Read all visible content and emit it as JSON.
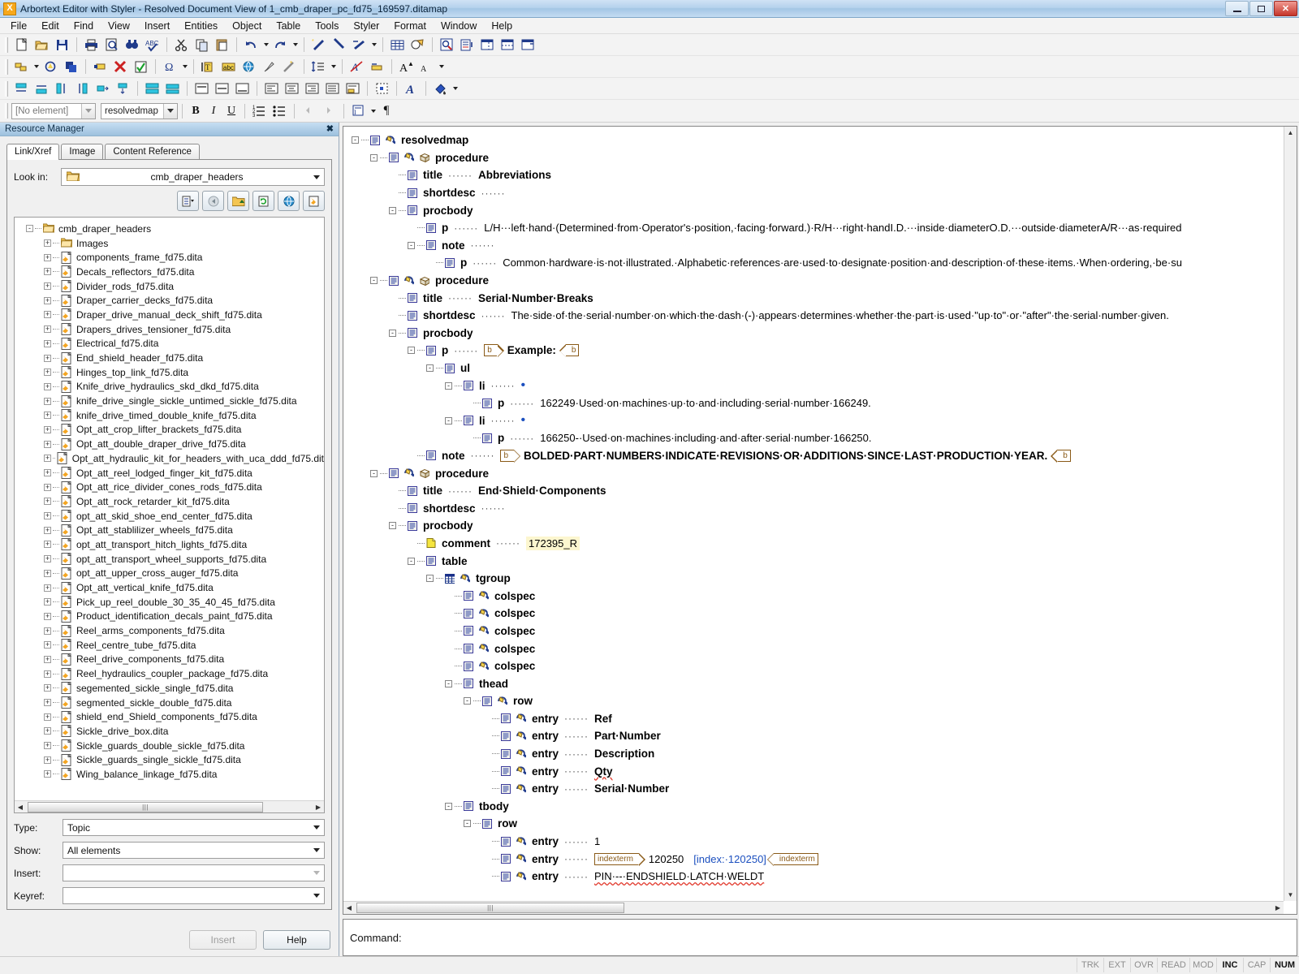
{
  "window": {
    "title": "Arbortext Editor with Styler - Resolved Document View of 1_cmb_draper_pc_fd75_169597.ditamap",
    "app_icon": "arbortext-icon",
    "minimize": "–",
    "restore": "❐",
    "close": "✕"
  },
  "menu": [
    {
      "label": "File"
    },
    {
      "label": "Edit"
    },
    {
      "label": "Find"
    },
    {
      "label": "View"
    },
    {
      "label": "Insert"
    },
    {
      "label": "Entities"
    },
    {
      "label": "Object"
    },
    {
      "label": "Table"
    },
    {
      "label": "Tools"
    },
    {
      "label": "Styler"
    },
    {
      "label": "Format"
    },
    {
      "label": "Window"
    },
    {
      "label": "Help"
    }
  ],
  "stylebar": {
    "element_combo_value": "[No element]",
    "context_combo_value": "resolvedmap",
    "bold": "B",
    "italic": "I",
    "underline": "U",
    "pilcrow": "¶"
  },
  "resource_manager": {
    "panel_title": "Resource Manager",
    "close_label": "✖",
    "tabs": [
      {
        "label": "Link/Xref",
        "active": true
      },
      {
        "label": "Image",
        "active": false
      },
      {
        "label": "Content Reference",
        "active": false
      }
    ],
    "look_in_label": "Look in:",
    "look_in_value": "cmb_draper_headers",
    "tree": [
      {
        "label": "cmb_draper_headers",
        "depth": 0,
        "type": "folder",
        "expander": "-"
      },
      {
        "label": "Images",
        "depth": 1,
        "type": "folder",
        "expander": "+"
      },
      {
        "label": "components_frame_fd75.dita",
        "depth": 1,
        "type": "file",
        "expander": "+"
      },
      {
        "label": "Decals_reflectors_fd75.dita",
        "depth": 1,
        "type": "file",
        "expander": "+"
      },
      {
        "label": "Divider_rods_fd75.dita",
        "depth": 1,
        "type": "file",
        "expander": "+"
      },
      {
        "label": "Draper_carrier_decks_fd75.dita",
        "depth": 1,
        "type": "file",
        "expander": "+"
      },
      {
        "label": "Draper_drive_manual_deck_shift_fd75.dita",
        "depth": 1,
        "type": "file",
        "expander": "+"
      },
      {
        "label": "Drapers_drives_tensioner_fd75.dita",
        "depth": 1,
        "type": "file",
        "expander": "+"
      },
      {
        "label": "Electrical_fd75.dita",
        "depth": 1,
        "type": "file",
        "expander": "+"
      },
      {
        "label": "End_shield_header_fd75.dita",
        "depth": 1,
        "type": "file",
        "expander": "+"
      },
      {
        "label": "Hinges_top_link_fd75.dita",
        "depth": 1,
        "type": "file",
        "expander": "+"
      },
      {
        "label": "Knife_drive_hydraulics_skd_dkd_fd75.dita",
        "depth": 1,
        "type": "file",
        "expander": "+"
      },
      {
        "label": "knife_drive_single_sickle_untimed_sickle_fd75.dita",
        "depth": 1,
        "type": "file",
        "expander": "+"
      },
      {
        "label": "knife_drive_timed_double_knife_fd75.dita",
        "depth": 1,
        "type": "file",
        "expander": "+"
      },
      {
        "label": "Opt_att_crop_lifter_brackets_fd75.dita",
        "depth": 1,
        "type": "file",
        "expander": "+"
      },
      {
        "label": "Opt_att_double_draper_drive_fd75.dita",
        "depth": 1,
        "type": "file",
        "expander": "+"
      },
      {
        "label": "Opt_att_hydraulic_kit_for_headers_with_uca_ddd_fd75.dit",
        "depth": 1,
        "type": "file",
        "expander": "+"
      },
      {
        "label": "Opt_att_reel_lodged_finger_kit_fd75.dita",
        "depth": 1,
        "type": "file",
        "expander": "+"
      },
      {
        "label": "Opt_att_rice_divider_cones_rods_fd75.dita",
        "depth": 1,
        "type": "file",
        "expander": "+"
      },
      {
        "label": "Opt_att_rock_retarder_kit_fd75.dita",
        "depth": 1,
        "type": "file",
        "expander": "+"
      },
      {
        "label": "opt_att_skid_shoe_end_center_fd75.dita",
        "depth": 1,
        "type": "file",
        "expander": "+"
      },
      {
        "label": "Opt_att_stablilizer_wheels_fd75.dita",
        "depth": 1,
        "type": "file",
        "expander": "+"
      },
      {
        "label": "opt_att_transport_hitch_lights_fd75.dita",
        "depth": 1,
        "type": "file",
        "expander": "+"
      },
      {
        "label": "opt_att_transport_wheel_supports_fd75.dita",
        "depth": 1,
        "type": "file",
        "expander": "+"
      },
      {
        "label": "opt_att_upper_cross_auger_fd75.dita",
        "depth": 1,
        "type": "file",
        "expander": "+"
      },
      {
        "label": "Opt_att_vertical_knife_fd75.dita",
        "depth": 1,
        "type": "file",
        "expander": "+"
      },
      {
        "label": "Pick_up_reel_double_30_35_40_45_fd75.dita",
        "depth": 1,
        "type": "file",
        "expander": "+"
      },
      {
        "label": "Product_identification_decals_paint_fd75.dita",
        "depth": 1,
        "type": "file",
        "expander": "+"
      },
      {
        "label": "Reel_arms_components_fd75.dita",
        "depth": 1,
        "type": "file",
        "expander": "+"
      },
      {
        "label": "Reel_centre_tube_fd75.dita",
        "depth": 1,
        "type": "file",
        "expander": "+"
      },
      {
        "label": "Reel_drive_components_fd75.dita",
        "depth": 1,
        "type": "file",
        "expander": "+"
      },
      {
        "label": "Reel_hydraulics_coupler_package_fd75.dita",
        "depth": 1,
        "type": "file",
        "expander": "+"
      },
      {
        "label": "segemented_sickle_single_fd75.dita",
        "depth": 1,
        "type": "file",
        "expander": "+"
      },
      {
        "label": "segmented_sickle_double_fd75.dita",
        "depth": 1,
        "type": "file",
        "expander": "+"
      },
      {
        "label": "shield_end_Shield_components_fd75.dita",
        "depth": 1,
        "type": "file",
        "expander": "+"
      },
      {
        "label": "Sickle_drive_box.dita",
        "depth": 1,
        "type": "file",
        "expander": "+"
      },
      {
        "label": "Sickle_guards_double_sickle_fd75.dita",
        "depth": 1,
        "type": "file",
        "expander": "+"
      },
      {
        "label": "Sickle_guards_single_sickle_fd75.dita",
        "depth": 1,
        "type": "file",
        "expander": "+"
      },
      {
        "label": "Wing_balance_linkage_fd75.dita",
        "depth": 1,
        "type": "file",
        "expander": "+"
      }
    ],
    "fields": [
      {
        "label": "Type:",
        "value": "Topic",
        "enabled": true
      },
      {
        "label": "Show:",
        "value": "All elements",
        "enabled": true
      },
      {
        "label": "Insert:",
        "value": "",
        "enabled": false
      },
      {
        "label": "Keyref:",
        "value": "",
        "enabled": true
      }
    ],
    "buttons": [
      {
        "label": "Insert",
        "enabled": false
      },
      {
        "label": "Help",
        "enabled": true
      }
    ]
  },
  "doctree": {
    "nodes": [
      {
        "depth": 0,
        "exp": "-",
        "tag": "resolvedmap",
        "icons": [
          "element",
          "attr"
        ],
        "leader": false,
        "text": ""
      },
      {
        "depth": 1,
        "exp": "-",
        "tag": "procedure",
        "icons": [
          "element",
          "attr",
          "cube"
        ],
        "leader": false,
        "text": ""
      },
      {
        "depth": 2,
        "exp": "",
        "tag": "title",
        "icons": [
          "element"
        ],
        "leader": true,
        "text": "Abbreviations",
        "bold": true
      },
      {
        "depth": 2,
        "exp": "",
        "tag": "shortdesc",
        "icons": [
          "element"
        ],
        "leader": true,
        "text": ""
      },
      {
        "depth": 2,
        "exp": "-",
        "tag": "procbody",
        "icons": [
          "element"
        ],
        "leader": false,
        "text": ""
      },
      {
        "depth": 3,
        "exp": "",
        "tag": "p",
        "icons": [
          "element"
        ],
        "leader": true,
        "text": "L/H···left·hand·(Determined·from·Operator's·position,·facing·forward.)·R/H···right·handI.D.···inside·diameterO.D.···outside·diameterA/R···as·required"
      },
      {
        "depth": 3,
        "exp": "-",
        "tag": "note",
        "icons": [
          "element"
        ],
        "leader": true,
        "text": ""
      },
      {
        "depth": 4,
        "exp": "",
        "tag": "p",
        "icons": [
          "element"
        ],
        "leader": true,
        "text": "Common·hardware·is·not·illustrated.·Alphabetic·references·are·used·to·designate·position·and·description·of·these·items.·When·ordering,·be·su"
      },
      {
        "depth": 1,
        "exp": "-",
        "tag": "procedure",
        "icons": [
          "element",
          "attr",
          "cube"
        ],
        "leader": false,
        "text": ""
      },
      {
        "depth": 2,
        "exp": "",
        "tag": "title",
        "icons": [
          "element"
        ],
        "leader": true,
        "text": "Serial·Number·Breaks",
        "bold": true
      },
      {
        "depth": 2,
        "exp": "",
        "tag": "shortdesc",
        "icons": [
          "element"
        ],
        "leader": true,
        "text": "The·side·of·the·serial·number·on·which·the·dash·(-)·appears·determines·whether·the·part·is·used·\"up·to\"·or·\"after\"·the·serial·number·given."
      },
      {
        "depth": 2,
        "exp": "-",
        "tag": "procbody",
        "icons": [
          "element"
        ],
        "leader": false,
        "text": ""
      },
      {
        "depth": 3,
        "exp": "-",
        "tag": "p",
        "icons": [
          "element"
        ],
        "leader": true,
        "marker_start": "b",
        "text": "Example:",
        "marker_end": "b",
        "bold": true
      },
      {
        "depth": 4,
        "exp": "-",
        "tag": "ul",
        "icons": [
          "element"
        ],
        "leader": false,
        "text": ""
      },
      {
        "depth": 5,
        "exp": "-",
        "tag": "li",
        "icons": [
          "element"
        ],
        "leader": true,
        "text": "•",
        "bullet": true
      },
      {
        "depth": 6,
        "exp": "",
        "tag": "p",
        "icons": [
          "element"
        ],
        "leader": true,
        "text": "162249·Used·on·machines·up·to·and·including·serial·number·166249."
      },
      {
        "depth": 5,
        "exp": "-",
        "tag": "li",
        "icons": [
          "element"
        ],
        "leader": true,
        "text": "•",
        "bullet": true
      },
      {
        "depth": 6,
        "exp": "",
        "tag": "p",
        "icons": [
          "element"
        ],
        "leader": true,
        "text": "166250-·Used·on·machines·including·and·after·serial·number·166250."
      },
      {
        "depth": 3,
        "exp": "",
        "tag": "note",
        "icons": [
          "element"
        ],
        "leader": true,
        "marker_start": "b",
        "text": "BOLDED·PART·NUMBERS·INDICATE·REVISIONS·OR·ADDITIONS·SINCE·LAST·PRODUCTION·YEAR.",
        "marker_end": "b",
        "bold": true
      },
      {
        "depth": 1,
        "exp": "-",
        "tag": "procedure",
        "icons": [
          "element",
          "attr",
          "cube"
        ],
        "leader": false,
        "text": ""
      },
      {
        "depth": 2,
        "exp": "",
        "tag": "title",
        "icons": [
          "element"
        ],
        "leader": true,
        "text": "End·Shield·Components",
        "bold": true
      },
      {
        "depth": 2,
        "exp": "",
        "tag": "shortdesc",
        "icons": [
          "element"
        ],
        "leader": true,
        "text": ""
      },
      {
        "depth": 2,
        "exp": "-",
        "tag": "procbody",
        "icons": [
          "element"
        ],
        "leader": false,
        "text": ""
      },
      {
        "depth": 3,
        "exp": "",
        "tag": "comment",
        "icons": [
          "comment"
        ],
        "leader": true,
        "text": "172395_R",
        "highlight": true
      },
      {
        "depth": 3,
        "exp": "-",
        "tag": "table",
        "icons": [
          "element"
        ],
        "leader": false,
        "text": ""
      },
      {
        "depth": 4,
        "exp": "-",
        "tag": "tgroup",
        "icons": [
          "table",
          "attr"
        ],
        "leader": false,
        "text": ""
      },
      {
        "depth": 5,
        "exp": "",
        "tag": "colspec",
        "icons": [
          "element",
          "attr"
        ],
        "leader": false,
        "text": ""
      },
      {
        "depth": 5,
        "exp": "",
        "tag": "colspec",
        "icons": [
          "element",
          "attr"
        ],
        "leader": false,
        "text": ""
      },
      {
        "depth": 5,
        "exp": "",
        "tag": "colspec",
        "icons": [
          "element",
          "attr"
        ],
        "leader": false,
        "text": ""
      },
      {
        "depth": 5,
        "exp": "",
        "tag": "colspec",
        "icons": [
          "element",
          "attr"
        ],
        "leader": false,
        "text": ""
      },
      {
        "depth": 5,
        "exp": "",
        "tag": "colspec",
        "icons": [
          "element",
          "attr"
        ],
        "leader": false,
        "text": ""
      },
      {
        "depth": 5,
        "exp": "-",
        "tag": "thead",
        "icons": [
          "element"
        ],
        "leader": false,
        "text": ""
      },
      {
        "depth": 6,
        "exp": "-",
        "tag": "row",
        "icons": [
          "element",
          "attr"
        ],
        "leader": false,
        "text": ""
      },
      {
        "depth": 7,
        "exp": "",
        "tag": "entry",
        "icons": [
          "element",
          "attr"
        ],
        "leader": true,
        "text": "Ref",
        "bold": true
      },
      {
        "depth": 7,
        "exp": "",
        "tag": "entry",
        "icons": [
          "element",
          "attr"
        ],
        "leader": true,
        "text": "Part·Number",
        "bold": true
      },
      {
        "depth": 7,
        "exp": "",
        "tag": "entry",
        "icons": [
          "element",
          "attr"
        ],
        "leader": true,
        "text": "Description",
        "bold": true
      },
      {
        "depth": 7,
        "exp": "",
        "tag": "entry",
        "icons": [
          "element",
          "attr"
        ],
        "leader": true,
        "text": "Qty",
        "bold": true,
        "spell": true
      },
      {
        "depth": 7,
        "exp": "",
        "tag": "entry",
        "icons": [
          "element",
          "attr"
        ],
        "leader": true,
        "text": "Serial·Number",
        "bold": true
      },
      {
        "depth": 5,
        "exp": "-",
        "tag": "tbody",
        "icons": [
          "element"
        ],
        "leader": false,
        "text": ""
      },
      {
        "depth": 6,
        "exp": "-",
        "tag": "row",
        "icons": [
          "element"
        ],
        "leader": false,
        "text": ""
      },
      {
        "depth": 7,
        "exp": "",
        "tag": "entry",
        "icons": [
          "element",
          "attr"
        ],
        "leader": true,
        "text": "1"
      },
      {
        "depth": 7,
        "exp": "",
        "tag": "entry",
        "icons": [
          "element",
          "attr"
        ],
        "leader": true,
        "text": "120250",
        "marker_start": "indexterm",
        "marker_mid": "[index:·120250]",
        "marker_end": "indexterm"
      },
      {
        "depth": 7,
        "exp": "",
        "tag": "entry",
        "icons": [
          "element",
          "attr"
        ],
        "leader": true,
        "text": "PIN·--·ENDSHIELD·LATCH·WELDT",
        "spell": true
      }
    ]
  },
  "command_bar": {
    "label": "Command:",
    "value": ""
  },
  "statusbar": {
    "cells": [
      {
        "label": "TRK",
        "on": false
      },
      {
        "label": "EXT",
        "on": false
      },
      {
        "label": "OVR",
        "on": false
      },
      {
        "label": "READ",
        "on": false
      },
      {
        "label": "MOD",
        "on": false
      },
      {
        "label": "INC",
        "on": true
      },
      {
        "label": "CAP",
        "on": false
      },
      {
        "label": "NUM",
        "on": true
      }
    ]
  },
  "colors": {
    "title_blue": "#a3c6e5",
    "tag_black": "#000000",
    "marker_brown": "#8a5a17",
    "index_blue": "#1b4fbf",
    "comment_highlight": "#fcf6cf",
    "spell_red": "#e23b2e"
  }
}
